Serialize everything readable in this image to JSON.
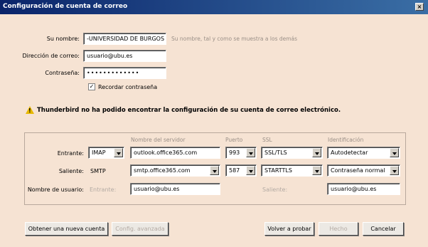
{
  "window": {
    "title": "Configuración de cuenta de correo",
    "close_glyph": "×"
  },
  "form": {
    "name_label": "Su nombre:",
    "name_value": "-UNIVERSIDAD DE BURGOS",
    "name_hint": "Su nombre, tal y como se muestra a los demás",
    "email_label": "Dirección de correo:",
    "email_value": "usuario@ubu.es",
    "password_label": "Contraseña:",
    "password_value": "•••••••••••••",
    "remember_label": "Recordar contraseña",
    "remember_checked": true
  },
  "warning": {
    "icon": "warning-icon",
    "text": "Thunderbird no ha podido encontrar la configuración de su cuenta de correo electrónico."
  },
  "server_grid": {
    "headers": {
      "server": "Nombre del servidor",
      "port": "Puerto",
      "ssl": "SSL",
      "auth": "Identificación"
    },
    "incoming": {
      "label": "Entrante:",
      "protocol": "IMAP",
      "server": "outlook.office365.com",
      "port": "993",
      "ssl": "SSL/TLS",
      "auth": "Autodetectar"
    },
    "outgoing": {
      "label": "Saliente:",
      "protocol": "SMTP",
      "server": "smtp.office365.com",
      "port": "587",
      "ssl": "STARTTLS",
      "auth": "Contraseña normal"
    },
    "username": {
      "label": "Nombre de usuario:",
      "incoming_label": "Entrante:",
      "incoming_value": "usuario@ubu.es",
      "outgoing_label": "Saliente:",
      "outgoing_value": "usuario@ubu.es"
    }
  },
  "buttons": {
    "new_account": "Obtener una nueva cuenta",
    "advanced": "Config. avanzada",
    "retest": "Volver a probar",
    "done": "Hecho",
    "cancel": "Cancelar"
  },
  "colors": {
    "background": "#f6e3d3",
    "titlebar": "#0a246a",
    "warning": "#e6b800"
  }
}
